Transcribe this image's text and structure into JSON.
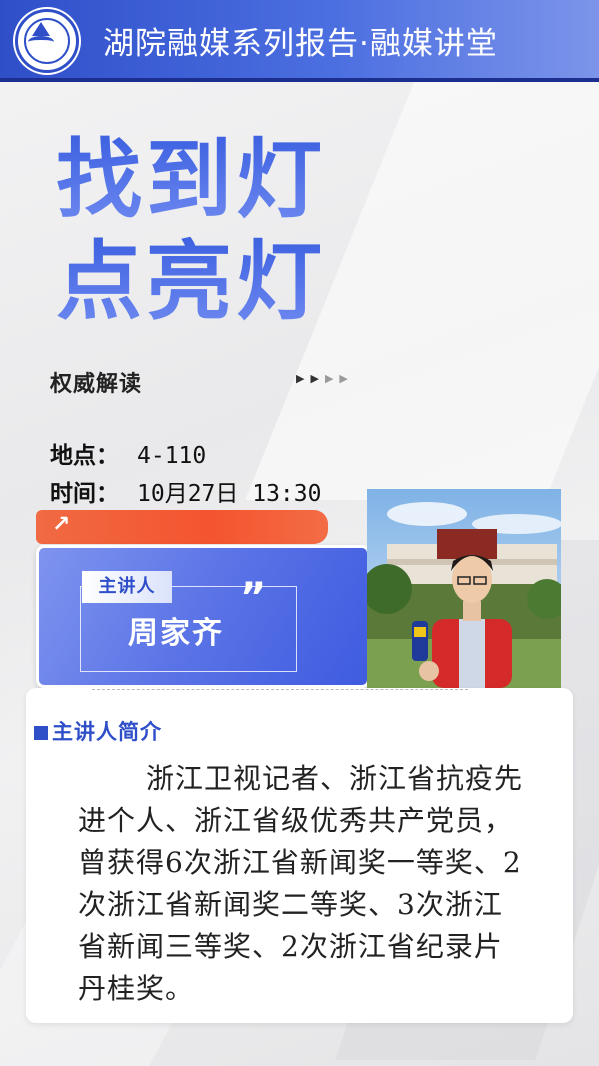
{
  "header": {
    "title": "湖院融媒系列报告·融媒讲堂",
    "logo_icon": "school-emblem-icon"
  },
  "headline": {
    "line1": "找到灯",
    "line2": "点亮灯"
  },
  "subtitle": "权威解读",
  "arrows": [
    "▶",
    "▶",
    "▶",
    "▶"
  ],
  "info": {
    "location_label": "地点：",
    "location_value": "4-110",
    "time_label": "时间：",
    "time_value": "10月27日 13:30"
  },
  "speaker": {
    "tag": "主讲人",
    "name": "周家齐",
    "quote_mark": "”",
    "photo_icon": "speaker-photo"
  },
  "bio": {
    "title": "主讲人简介",
    "text": "浙江卫视记者、浙江省抗疫先进个人、浙江省级优秀共产党员，曾获得6次浙江省新闻奖一等奖、2次浙江省新闻奖二等奖、3次浙江省新闻三等奖、2次浙江省纪录片丹桂奖。"
  },
  "colors": {
    "brand_blue": "#2f4fc9",
    "accent_orange": "#f4542f"
  }
}
